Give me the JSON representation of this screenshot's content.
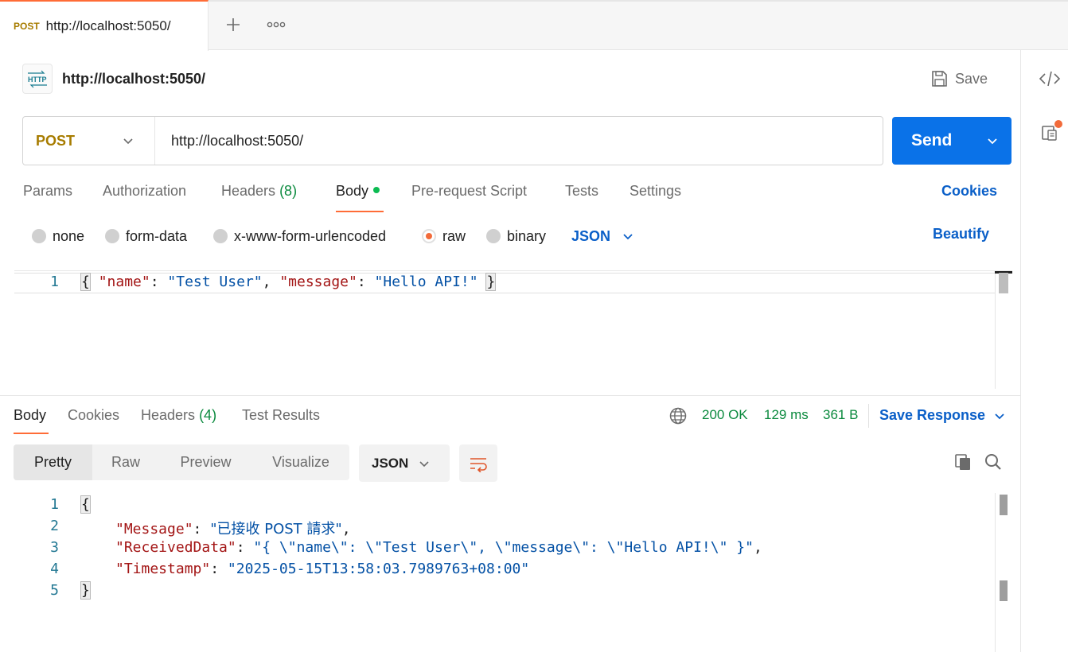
{
  "tabs": {
    "active": {
      "method": "POST",
      "url": "http://localhost:5050/"
    }
  },
  "request": {
    "name": "http://localhost:5050/",
    "save_label": "Save",
    "method": "POST",
    "url": "http://localhost:5050/",
    "send_label": "Send",
    "tabs": [
      {
        "label": "Params"
      },
      {
        "label": "Authorization"
      },
      {
        "label": "Headers",
        "count": "(8)"
      },
      {
        "label": "Body"
      },
      {
        "label": "Pre-request Script"
      },
      {
        "label": "Tests"
      },
      {
        "label": "Settings"
      }
    ],
    "cookies_label": "Cookies",
    "body_types": [
      "none",
      "form-data",
      "x-www-form-urlencoded",
      "raw",
      "binary"
    ],
    "selected_body_type": "raw",
    "language": "JSON",
    "beautify_label": "Beautify",
    "editor": {
      "line_number": "1",
      "tokens": {
        "open": "{",
        "k1": "\"name\"",
        "colon": ": ",
        "v1": "\"Test User\"",
        "comma": ", ",
        "k2": "\"message\"",
        "v2": "\"Hello API!\"",
        "close": "}"
      }
    }
  },
  "response": {
    "tabs": [
      {
        "label": "Body"
      },
      {
        "label": "Cookies"
      },
      {
        "label": "Headers",
        "count": "(4)"
      },
      {
        "label": "Test Results"
      }
    ],
    "status": "200 OK",
    "time": "129 ms",
    "size": "361 B",
    "save_response_label": "Save Response",
    "view_modes": [
      "Pretty",
      "Raw",
      "Preview",
      "Visualize"
    ],
    "format": "JSON",
    "lines": {
      "l1": {
        "num": "1",
        "text": "{"
      },
      "l2": {
        "num": "2",
        "key": "\"Message\"",
        "value": "\"已接收 POST 請求\"",
        "trail": ","
      },
      "l3": {
        "num": "3",
        "key": "\"ReceivedData\"",
        "value": "\"{ \\\"name\\\": \\\"Test User\\\", \\\"message\\\": \\\"Hello API!\\\" }\"",
        "trail": ","
      },
      "l4": {
        "num": "4",
        "key": "\"Timestamp\"",
        "value": "\"2025-05-15T13:58:03.7989763+08:00\"",
        "trail": ""
      },
      "l5": {
        "num": "5",
        "text": "}"
      }
    }
  },
  "colors": {
    "accent": "#ff6c37",
    "send_button": "#0a72e8",
    "link_blue": "#0a5fc8",
    "status_green": "#0b8a3e",
    "method_post": "#a77c00"
  },
  "icons": [
    "plus-icon",
    "more-horizontal-icon",
    "http-icon",
    "save-icon",
    "chevron-down-icon",
    "code-icon",
    "snippet-icon",
    "globe-icon",
    "wrap-lines-icon",
    "copy-icon",
    "search-icon"
  ]
}
